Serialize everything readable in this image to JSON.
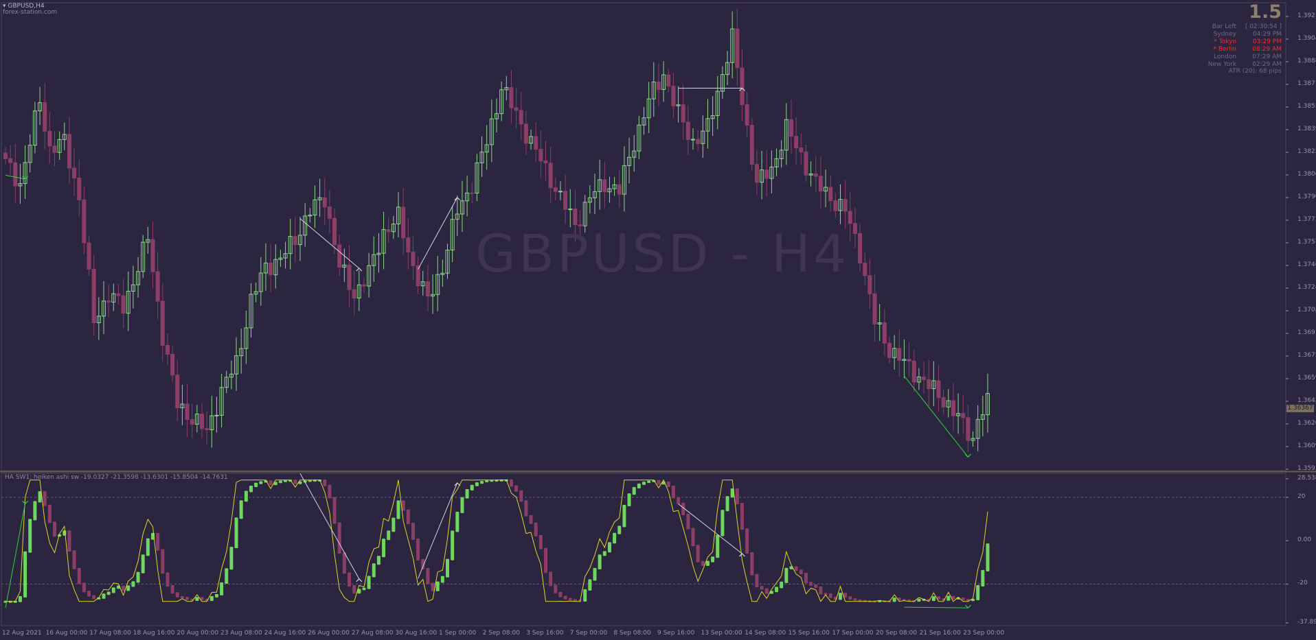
{
  "window": {
    "symbol_title": "GBPUSD,H4",
    "site": "forex-station.com",
    "watermark": "GBPUSD - H4"
  },
  "info_panel": {
    "big_value": "1.5",
    "rows": [
      {
        "label": "Bar Left",
        "value": "[ 02:30:54 ]",
        "highlight": false
      },
      {
        "label": "Sydney",
        "value": "04:29 PM",
        "highlight": false
      },
      {
        "label": "* Tokyo",
        "value": "03:29 PM",
        "highlight": true
      },
      {
        "label": "* Berlin",
        "value": "08:29 AM",
        "highlight": true
      },
      {
        "label": "London",
        "value": "07:29 AM",
        "highlight": false
      },
      {
        "label": "New York",
        "value": "02:29 AM",
        "highlight": false
      },
      {
        "label": "ATR (20): 68 pips",
        "value": "",
        "highlight": false
      }
    ]
  },
  "price_axis": {
    "ticks": [
      "1.39210",
      "1.39045",
      "1.38880",
      "1.38715",
      "1.38555",
      "1.38390",
      "1.38225",
      "1.38060",
      "1.37900",
      "1.37735",
      "1.37570",
      "1.37405",
      "1.37245",
      "1.37080",
      "1.36915",
      "1.36750",
      "1.36590",
      "1.36425",
      "1.36260",
      "1.36095",
      "1.35930"
    ],
    "current_price": "1.36367"
  },
  "indicator": {
    "title": "HA SW1: heiken ashi sw -19.0327 -21.3598 -13.6301 -15.8504 -14.7631",
    "axis_ticks": [
      "28.5388",
      "20",
      "0.00",
      "-20",
      "-37.8984"
    ]
  },
  "time_axis": {
    "labels": [
      "12 Aug 2021",
      "16 Aug 00:00",
      "17 Aug 08:00",
      "18 Aug 16:00",
      "20 Aug 00:00",
      "23 Aug 08:00",
      "24 Aug 16:00",
      "26 Aug 00:00",
      "27 Aug 08:00",
      "30 Aug 16:00",
      "1 Sep 00:00",
      "2 Sep 08:00",
      "3 Sep 16:00",
      "7 Sep 00:00",
      "8 Sep 08:00",
      "9 Sep 16:00",
      "13 Sep 00:00",
      "14 Sep 08:00",
      "15 Sep 16:00",
      "17 Sep 00:00",
      "20 Sep 08:00",
      "21 Sep 16:00",
      "23 Sep 00:00"
    ]
  },
  "colors": {
    "background": "#2b2540",
    "bull": "#8fd68a",
    "bear": "#8c3e66",
    "ha_bull": "#6fd65f",
    "ha_bear": "#8c3e66",
    "signal_line": "#e0d62a",
    "divergence_bear": "#d6d2e6",
    "divergence_bull": "#2fd63d",
    "axis": "#9a93ad",
    "highlight": "#ff2a2a"
  },
  "chart_data": {
    "type": "candlestick",
    "symbol": "GBPUSD",
    "timeframe": "H4",
    "ylim": [
      1.3593,
      1.3921
    ],
    "close_anchors": [
      [
        0,
        1.3815
      ],
      [
        3,
        1.38
      ],
      [
        5,
        1.383
      ],
      [
        7,
        1.386
      ],
      [
        9,
        1.3825
      ],
      [
        12,
        1.383
      ],
      [
        15,
        1.379
      ],
      [
        18,
        1.37
      ],
      [
        21,
        1.372
      ],
      [
        24,
        1.371
      ],
      [
        27,
        1.374
      ],
      [
        29,
        1.376
      ],
      [
        32,
        1.369
      ],
      [
        35,
        1.364
      ],
      [
        38,
        1.363
      ],
      [
        41,
        1.362
      ],
      [
        44,
        1.365
      ],
      [
        47,
        1.367
      ],
      [
        50,
        1.3715
      ],
      [
        53,
        1.374
      ],
      [
        56,
        1.3745
      ],
      [
        59,
        1.376
      ],
      [
        62,
        1.378
      ],
      [
        65,
        1.379
      ],
      [
        68,
        1.374
      ],
      [
        71,
        1.372
      ],
      [
        74,
        1.3735
      ],
      [
        77,
        1.3765
      ],
      [
        80,
        1.3775
      ],
      [
        83,
        1.374
      ],
      [
        86,
        1.3715
      ],
      [
        89,
        1.374
      ],
      [
        92,
        1.378
      ],
      [
        95,
        1.38
      ],
      [
        98,
        1.383
      ],
      [
        101,
        1.387
      ],
      [
        104,
        1.385
      ],
      [
        107,
        1.383
      ],
      [
        110,
        1.381
      ],
      [
        113,
        1.379
      ],
      [
        116,
        1.377
      ],
      [
        119,
        1.379
      ],
      [
        122,
        1.38
      ],
      [
        125,
        1.3795
      ],
      [
        128,
        1.383
      ],
      [
        131,
        1.386
      ],
      [
        134,
        1.388
      ],
      [
        137,
        1.385
      ],
      [
        140,
        1.383
      ],
      [
        143,
        1.384
      ],
      [
        146,
        1.388
      ],
      [
        148,
        1.3905
      ],
      [
        150,
        1.386
      ],
      [
        153,
        1.38
      ],
      [
        156,
        1.381
      ],
      [
        159,
        1.384
      ],
      [
        162,
        1.382
      ],
      [
        165,
        1.38
      ],
      [
        168,
        1.379
      ],
      [
        171,
        1.378
      ],
      [
        174,
        1.375
      ],
      [
        177,
        1.37
      ],
      [
        180,
        1.368
      ],
      [
        183,
        1.367
      ],
      [
        186,
        1.366
      ],
      [
        189,
        1.365
      ],
      [
        192,
        1.364
      ],
      [
        195,
        1.3625
      ],
      [
        197,
        1.3615
      ],
      [
        198,
        1.363
      ],
      [
        200,
        1.364
      ]
    ],
    "overlays": [
      {
        "type": "bearish_divergence",
        "from_bar": 60,
        "to_bar": 72
      },
      {
        "type": "bearish_divergence",
        "from_bar": 84,
        "to_bar": 92
      },
      {
        "type": "bearish_divergence",
        "from_bar": 137,
        "to_bar": 150
      },
      {
        "type": "bullish_divergence",
        "from_bar": 0,
        "to_bar": 4
      },
      {
        "type": "bullish_divergence",
        "from_bar": 183,
        "to_bar": 196
      }
    ]
  }
}
